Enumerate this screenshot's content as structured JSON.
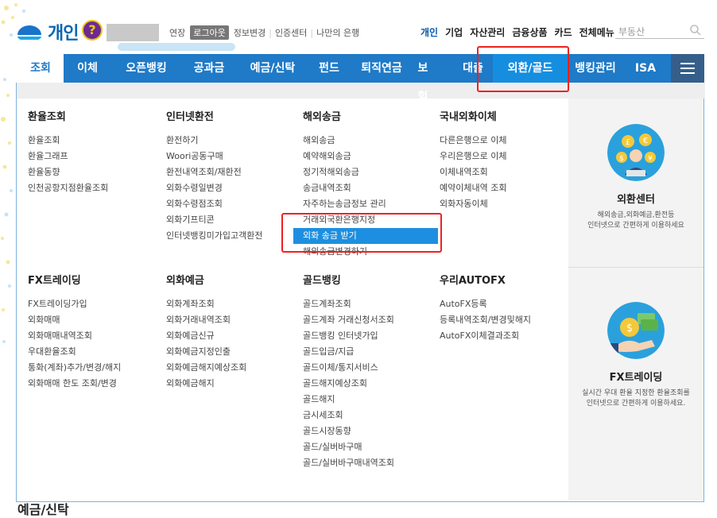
{
  "header": {
    "logo_text": "개인",
    "top_links": [
      "연장",
      "로그아웃",
      "정보변경",
      "인증센터",
      "나만의 은행"
    ],
    "channel_menu": [
      "개인",
      "기업",
      "자산관리",
      "금융상품",
      "카드",
      "전체메뉴"
    ],
    "search_placeholder": "부동산"
  },
  "gnb": {
    "tabs": [
      "조회",
      "이체",
      "오픈뱅킹",
      "공과금",
      "예금/신탁",
      "펀드",
      "퇴직연금",
      "보험",
      "대출",
      "외환/골드",
      "뱅킹관리",
      "ISA"
    ]
  },
  "megamenu": {
    "sections": [
      {
        "title": "환율조회",
        "links": [
          "환율조회",
          "환율그래프",
          "환율동향",
          "인천공항지점환율조회"
        ]
      },
      {
        "title": "인터넷환전",
        "links": [
          "환전하기",
          "Woori공동구매",
          "환전내역조회/재환전",
          "외화수령일변경",
          "외화수령점조회",
          "외화기프티콘",
          "인터넷뱅킹미가입고객환전"
        ]
      },
      {
        "title": "해외송금",
        "links": [
          "해외송금",
          "예약해외송금",
          "정기적해외송금",
          "송금내역조회",
          "자주하는송금정보 관리",
          "거래외국환은행지정",
          "외화 송금 받기",
          "해외송금변경하기"
        ]
      },
      {
        "title": "국내외화이체",
        "links": [
          "다른은행으로 이체",
          "우리은행으로 이체",
          "이체내역조회",
          "예약이체내역 조회",
          "외화자동이체"
        ]
      },
      {
        "title": "FX트레이딩",
        "links": [
          "FX트레이딩가입",
          "외화매매",
          "외화매매내역조회",
          "우대환율조회",
          "통화(계좌)추가/변경/해지",
          "외화매매 한도 조회/변경"
        ]
      },
      {
        "title": "외화예금",
        "links": [
          "외화계좌조회",
          "외화거래내역조회",
          "외화예금신규",
          "외화예금지정인출",
          "외화예금해지예상조회",
          "외화예금해지"
        ]
      },
      {
        "title": "골드뱅킹",
        "links": [
          "골드계좌조회",
          "골드계좌 거래신청서조회",
          "골드뱅킹 인터넷가입",
          "골드입금/지급",
          "골드이체/통지서비스",
          "골드해지예상조회",
          "골드해지",
          "금시세조회",
          "골드시장동향",
          "골드/실버바구매",
          "골드/실버바구매내역조회"
        ]
      },
      {
        "title": "우리AUTOFX",
        "links": [
          "AutoFX등록",
          "등록내역조회/변경및해지",
          "AutoFX이체결과조회"
        ]
      }
    ]
  },
  "side": {
    "blocks": [
      {
        "title": "외환센터",
        "desc1": "해외송금,외화예금,환전등",
        "desc2": "인터넷으로 간편하게 이용하세요"
      },
      {
        "title": "FX트레이딩",
        "desc1": "실시간 우대 환율 지정한 환율조회를",
        "desc2": "인터넷으로 간편하게 이용하세요."
      }
    ]
  },
  "bottom_peek": "예금/신탁"
}
